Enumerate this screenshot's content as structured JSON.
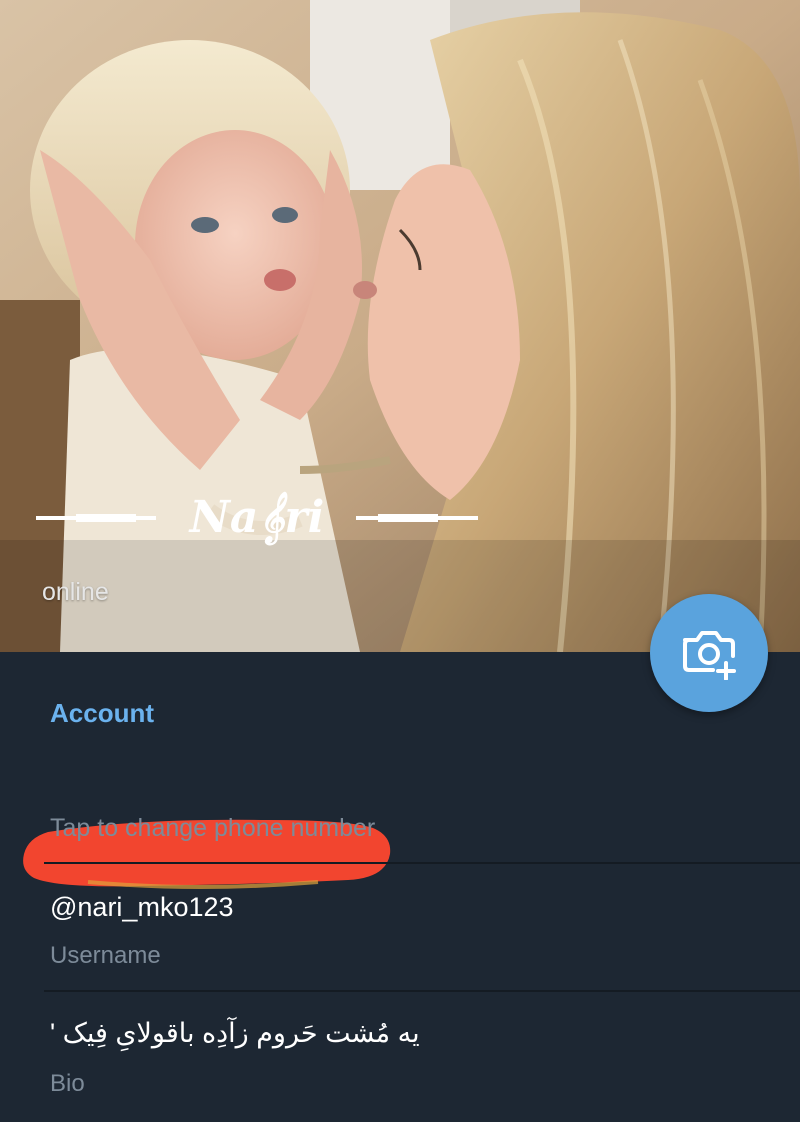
{
  "profile": {
    "status": "online",
    "logo_text": "Na𝄞ri",
    "camera_button": {
      "icon": "camera-add-icon"
    }
  },
  "account": {
    "title": "Account",
    "phone_hint": "Tap to change phone number",
    "username_value": "@nari_mko123",
    "username_label": "Username",
    "bio_value": "یه مُشت حَروم زآدِه باقولایِ فِیک '",
    "bio_label": "Bio"
  },
  "colors": {
    "background": "#1d2733",
    "accent": "#6bb2ee",
    "fab": "#5aa3dd",
    "redaction": "#f2452f"
  }
}
